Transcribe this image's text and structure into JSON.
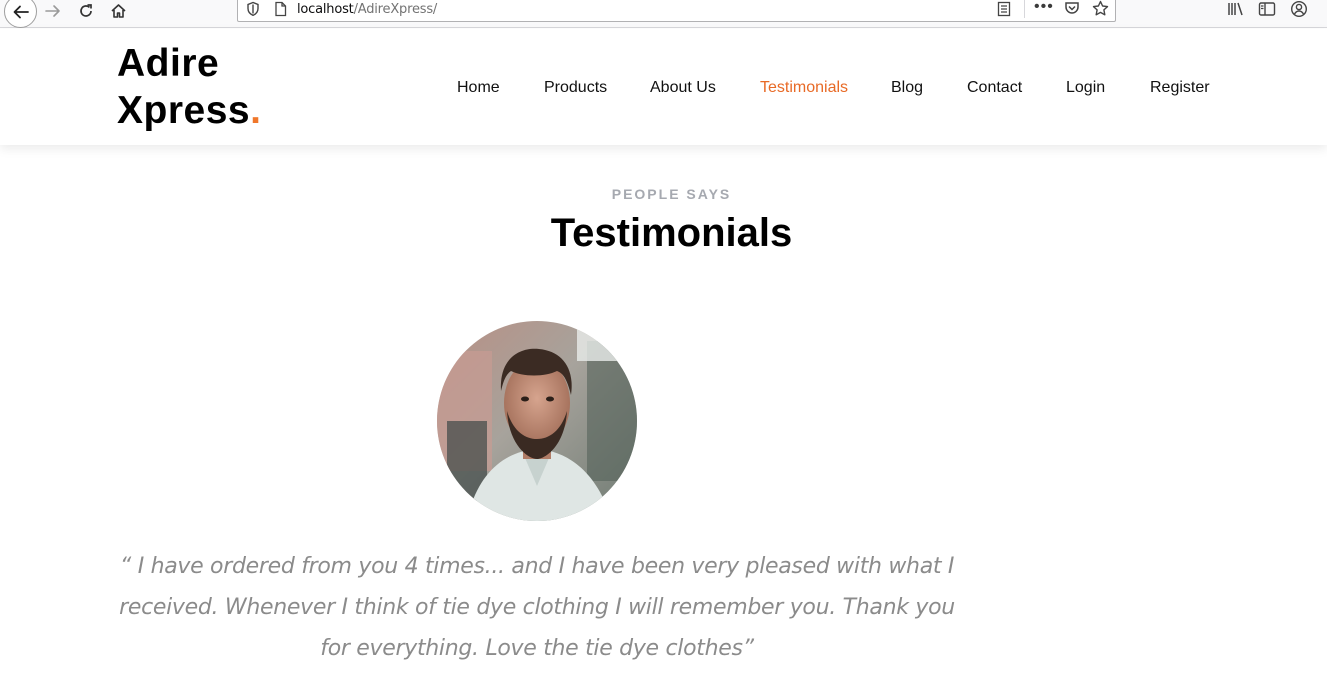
{
  "browser": {
    "url_host": "localhost",
    "url_path": "/AdireXpress/",
    "icons": [
      "back-icon",
      "forward-icon",
      "reload-icon",
      "home-icon",
      "shield-icon",
      "page-icon",
      "reader-view-icon",
      "more-icon",
      "pocket-icon",
      "star-icon",
      "library-icon",
      "sidebar-icon",
      "account-icon"
    ]
  },
  "site": {
    "logo_line1": "Adire",
    "logo_line2": "Xpress",
    "logo_dot": ".",
    "accent_color": "#f0772b",
    "nav": {
      "home": "Home",
      "products": "Products",
      "about": "About Us",
      "testimonials": "Testimonials",
      "blog": "Blog",
      "contact": "Contact",
      "login": "Login",
      "register": "Register"
    },
    "active_nav": "Testimonials"
  },
  "testimonials": {
    "eyebrow": "PEOPLE SAYS",
    "title": "Testimonials",
    "quote": "“ I have ordered from you 4 times... and I have been very pleased with what I received. Whenever I think of tie dye clothing I will remember you. Thank you for everything. Love the tie dye clothes”"
  }
}
